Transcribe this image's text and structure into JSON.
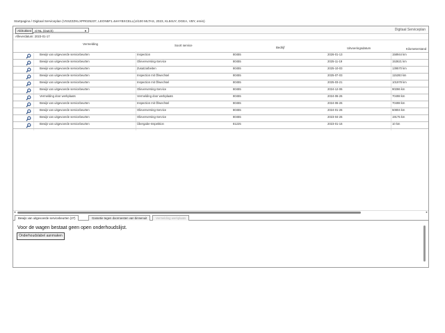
{
  "page_title": "Startpagina / Digitaal Serviceplan (VSSZZZKLXPR025237, LEON5F1.4eHYBXCELL(U/100 MLTAS, 2023, KL84UY, DGEA, VBY, erein)",
  "toolbar": {
    "print_label": "Afdrukken",
    "language_value": "nl-NL (Dutch)",
    "app_label": "Digitaal Serviceplan"
  },
  "report_date": "Afleverdatum: 2023-01-17",
  "table": {
    "headers": {
      "vermelding": "Vermelding",
      "soort_service": "Soort service",
      "bedrijf": "Bedrijf",
      "datum": "Uitvoeringsdatum",
      "km": "Kilometerstand"
    },
    "rows": [
      {
        "vermelding": "Bewijs van uitgevoerde servicebeurten",
        "service": "Inspection",
        "bedrijf": "80455",
        "datum": "2026-01-13",
        "km": "158944 km"
      },
      {
        "vermelding": "Bewijs van uitgevoerde servicebeurten",
        "service": "Olieverversing-Service",
        "bedrijf": "80455",
        "datum": "2025-11-19",
        "km": "153621 km"
      },
      {
        "vermelding": "Bewijs van uitgevoerde servicebeurten",
        "service": "Zusatzarbeiten",
        "bedrijf": "80455",
        "datum": "2025-10-03",
        "km": "139570 km"
      },
      {
        "vermelding": "Bewijs van uitgevoerde servicebeurten",
        "service": "Inspection mit Ölwechsel",
        "bedrijf": "80455",
        "datum": "2025-07-03",
        "km": "115283 km"
      },
      {
        "vermelding": "Bewijs van uitgevoerde servicebeurten",
        "service": "Inspection mit Ölwechsel",
        "bedrijf": "80455",
        "datum": "2025-03-21",
        "km": "101978 km"
      },
      {
        "vermelding": "Bewijs van uitgevoerde servicebeurten",
        "service": "Olieverversing-Service",
        "bedrijf": "80455",
        "datum": "2024-12-06",
        "km": "90286 km"
      },
      {
        "vermelding": "Vermelding door werkplaats",
        "service": "Vermelding door werkplaats",
        "bedrijf": "80455",
        "datum": "2024-06-26",
        "km": "70498 km"
      },
      {
        "vermelding": "Bewijs van uitgevoerde servicebeurten",
        "service": "Inspection mit Ölwechsel",
        "bedrijf": "80455",
        "datum": "2024-06-26",
        "km": "70498 km"
      },
      {
        "vermelding": "Bewijs van uitgevoerde servicebeurten",
        "service": "Olieverversing-Service",
        "bedrijf": "80455",
        "datum": "2024-01-26",
        "km": "50804 km"
      },
      {
        "vermelding": "Bewijs van uitgevoerde servicebeurten",
        "service": "Olieverversing-Service",
        "bedrijf": "80455",
        "datum": "2023-04-26",
        "km": "19175 km"
      },
      {
        "vermelding": "Bewijs van uitgevoerde servicebeurten",
        "service": "Übergabe-Inspektion",
        "bedrijf": "81225",
        "datum": "2023-01-16",
        "km": "10 km"
      }
    ]
  },
  "tabs": [
    {
      "label": "Bewijs van uitgevoerde servicebeurten (27)"
    },
    {
      "label": "Garantie tegen doorroesten van binnenuit"
    },
    {
      "label": "Vermelding werkplaats"
    }
  ],
  "panel": {
    "message": "Voor de wagen bestaat geen open onderhoudslijst.",
    "button_label": "Onderhoudslabel aanmaken"
  },
  "icons": {
    "row_icon": "magnifier-icon",
    "chevron": "chevron-down-icon"
  },
  "colors": {
    "border": "#9a9a9a",
    "row_border": "#bdbdbd",
    "icon_blue": "#2c4f86"
  }
}
